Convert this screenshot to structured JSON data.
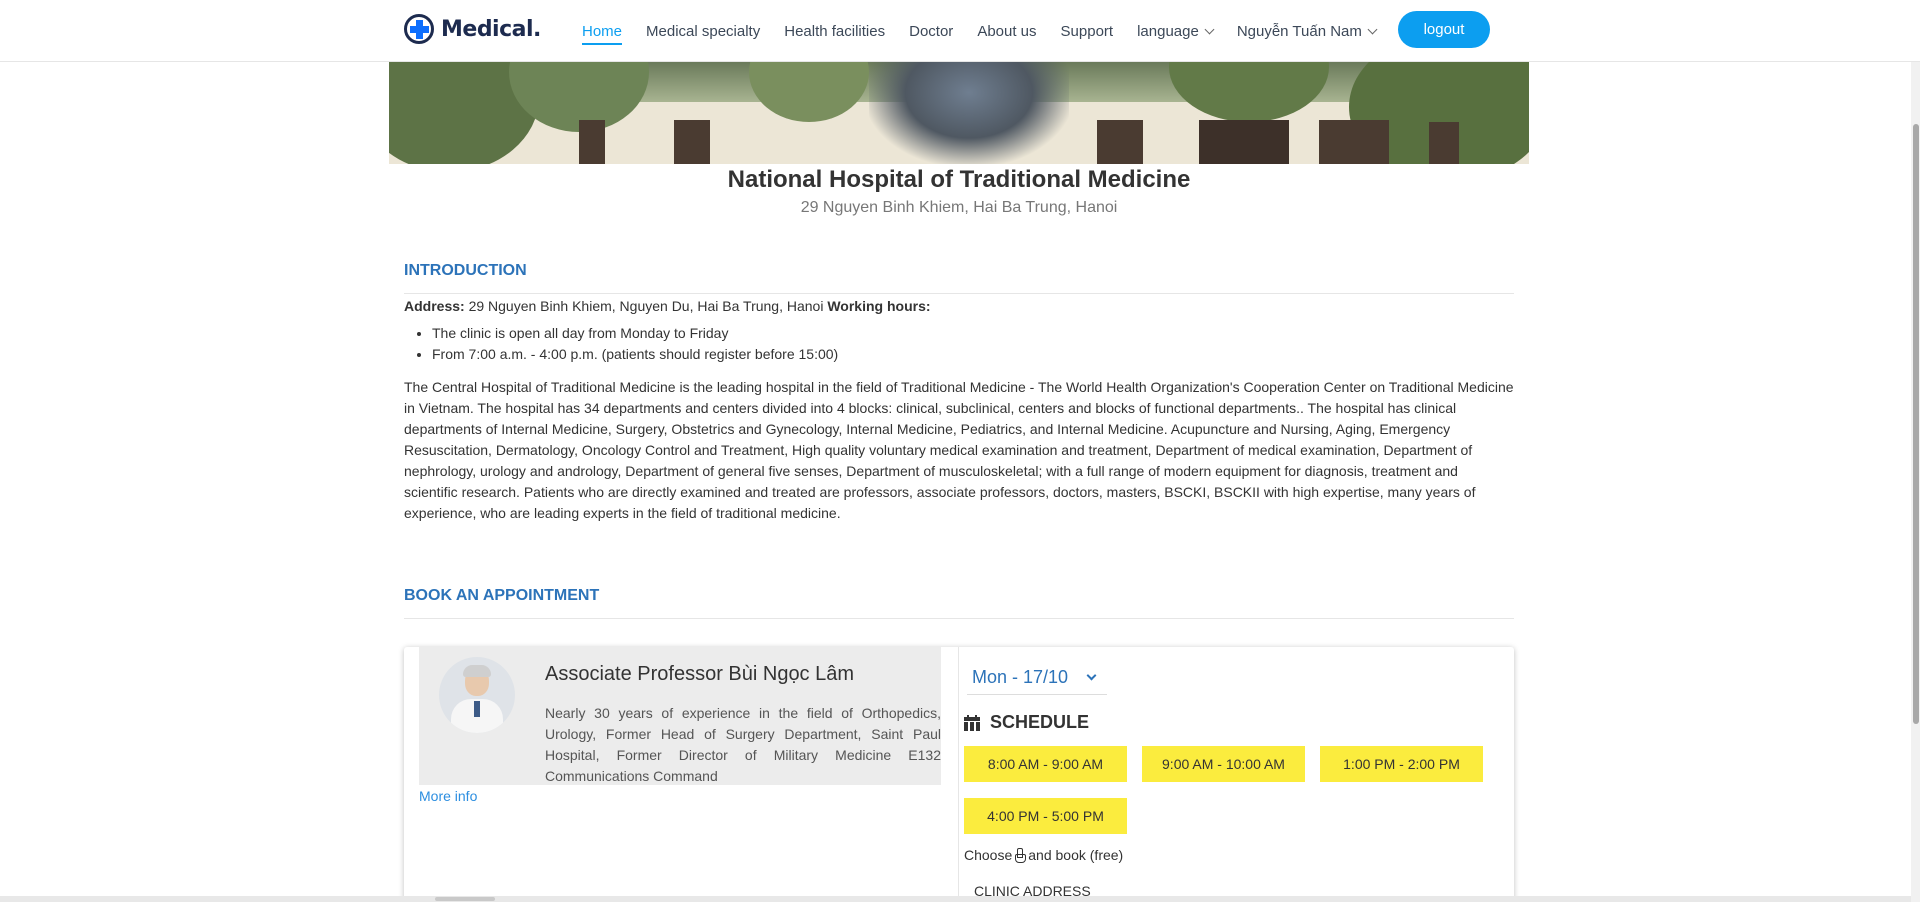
{
  "header": {
    "logo_text": "Medical.",
    "nav": [
      {
        "label": "Home",
        "active": true
      },
      {
        "label": "Medical specialty"
      },
      {
        "label": "Health facilities"
      },
      {
        "label": "Doctor"
      },
      {
        "label": "About us"
      },
      {
        "label": "Support"
      },
      {
        "label": "language",
        "dropdown": true
      },
      {
        "label": "Nguyễn Tuấn Nam",
        "dropdown": true
      }
    ],
    "logout_label": "logout",
    "accent_color": "#0c9ef0"
  },
  "hospital": {
    "name": "National Hospital of Traditional Medicine",
    "address": "29 Nguyen Binh Khiem, Hai Ba Trung, Hanoi"
  },
  "introduction": {
    "heading": "INTRODUCTION",
    "address_label": "Address:",
    "address_value": " 29 Nguyen Binh Khiem, Nguyen Du, Hai Ba Trung, Hanoi ",
    "working_hours_label": "Working hours:",
    "hours": [
      "The clinic is open all day from Monday to Friday",
      "From 7:00 a.m. - 4:00 p.m. (patients should register before 15:00)"
    ],
    "body": "The Central Hospital of Traditional Medicine is the leading hospital in the field of Traditional Medicine - The World Health Organization's Cooperation Center on Traditional Medicine in Vietnam. The hospital has 34 departments and centers divided into 4 blocks: clinical, subclinical, centers and blocks of functional departments.. The hospital has clinical departments of Internal Medicine, Surgery, Obstetrics and Gynecology, Internal Medicine, Pediatrics, and Internal Medicine. Acupuncture and Nursing, Aging, Emergency Resuscitation, Dermatology, Oncology Control and Treatment, High quality voluntary medical examination and treatment, Department of medical examination, Department of nephrology, urology and andrology, Department of general five senses, Department of musculoskeletal; with a full range of modern equipment for diagnosis, treatment and scientific research. Patients who are directly examined and treated are professors, associate professors, doctors, masters, BSCKI, BSCKII with high expertise, many years of experience, who are leading experts in the field of traditional medicine."
  },
  "booking": {
    "heading": "BOOK AN APPOINTMENT",
    "doctor": {
      "name": "Associate Professor Bùi Ngọc Lâm",
      "description": "Nearly 30 years of experience in the field of Orthopedics, Urology, Former Head of Surgery Department, Saint Paul Hospital, Former Director of Military Medicine E132 Communications Command",
      "more_info": "More info"
    },
    "date": "Mon - 17/10",
    "schedule_title": "SCHEDULE",
    "slots": [
      "8:00 AM - 9:00 AM",
      "9:00 AM - 10:00 AM",
      "1:00 PM - 2:00 PM",
      "4:00 PM - 5:00 PM"
    ],
    "choose_prefix": "Choose",
    "choose_suffix": "and book (free)",
    "clinic_address_label": "CLINIC ADDRESS",
    "slot_color": "#fbec3e",
    "heading_color": "#2c73b9"
  }
}
